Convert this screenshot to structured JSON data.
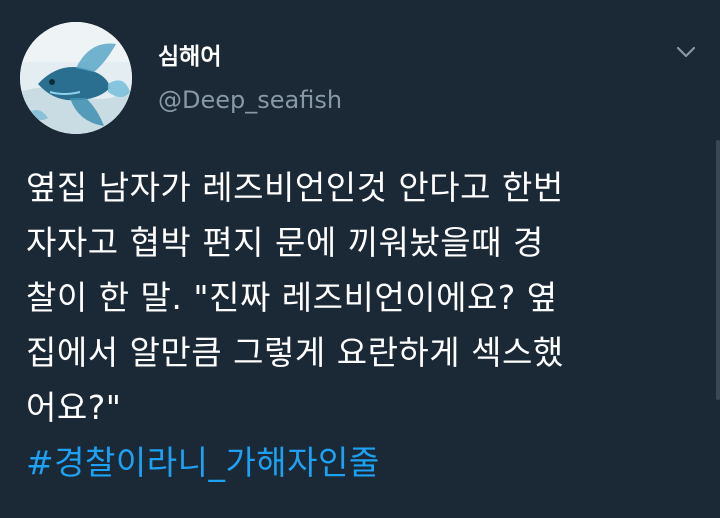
{
  "user": {
    "display_name": "심해어",
    "handle": "@Deep_seafish"
  },
  "menu": {
    "icon": "chevron-down-icon"
  },
  "tweet": {
    "lines": [
      "옆집 남자가 레즈비언인것 안다고 한번",
      "자자고 협박 편지 문에 끼워놨을때  경",
      "찰이 한 말.  \"진짜 레즈비언이에요? 옆",
      "집에서 알만큼 그렇게 요란하게 섹스했",
      "어요?\""
    ],
    "hashtag": "#경찰이라니_가해자인줄"
  },
  "colors": {
    "background": "#1b2836",
    "text": "#ffffff",
    "handle": "#8899a6",
    "hashtag": "#1da1f2"
  }
}
